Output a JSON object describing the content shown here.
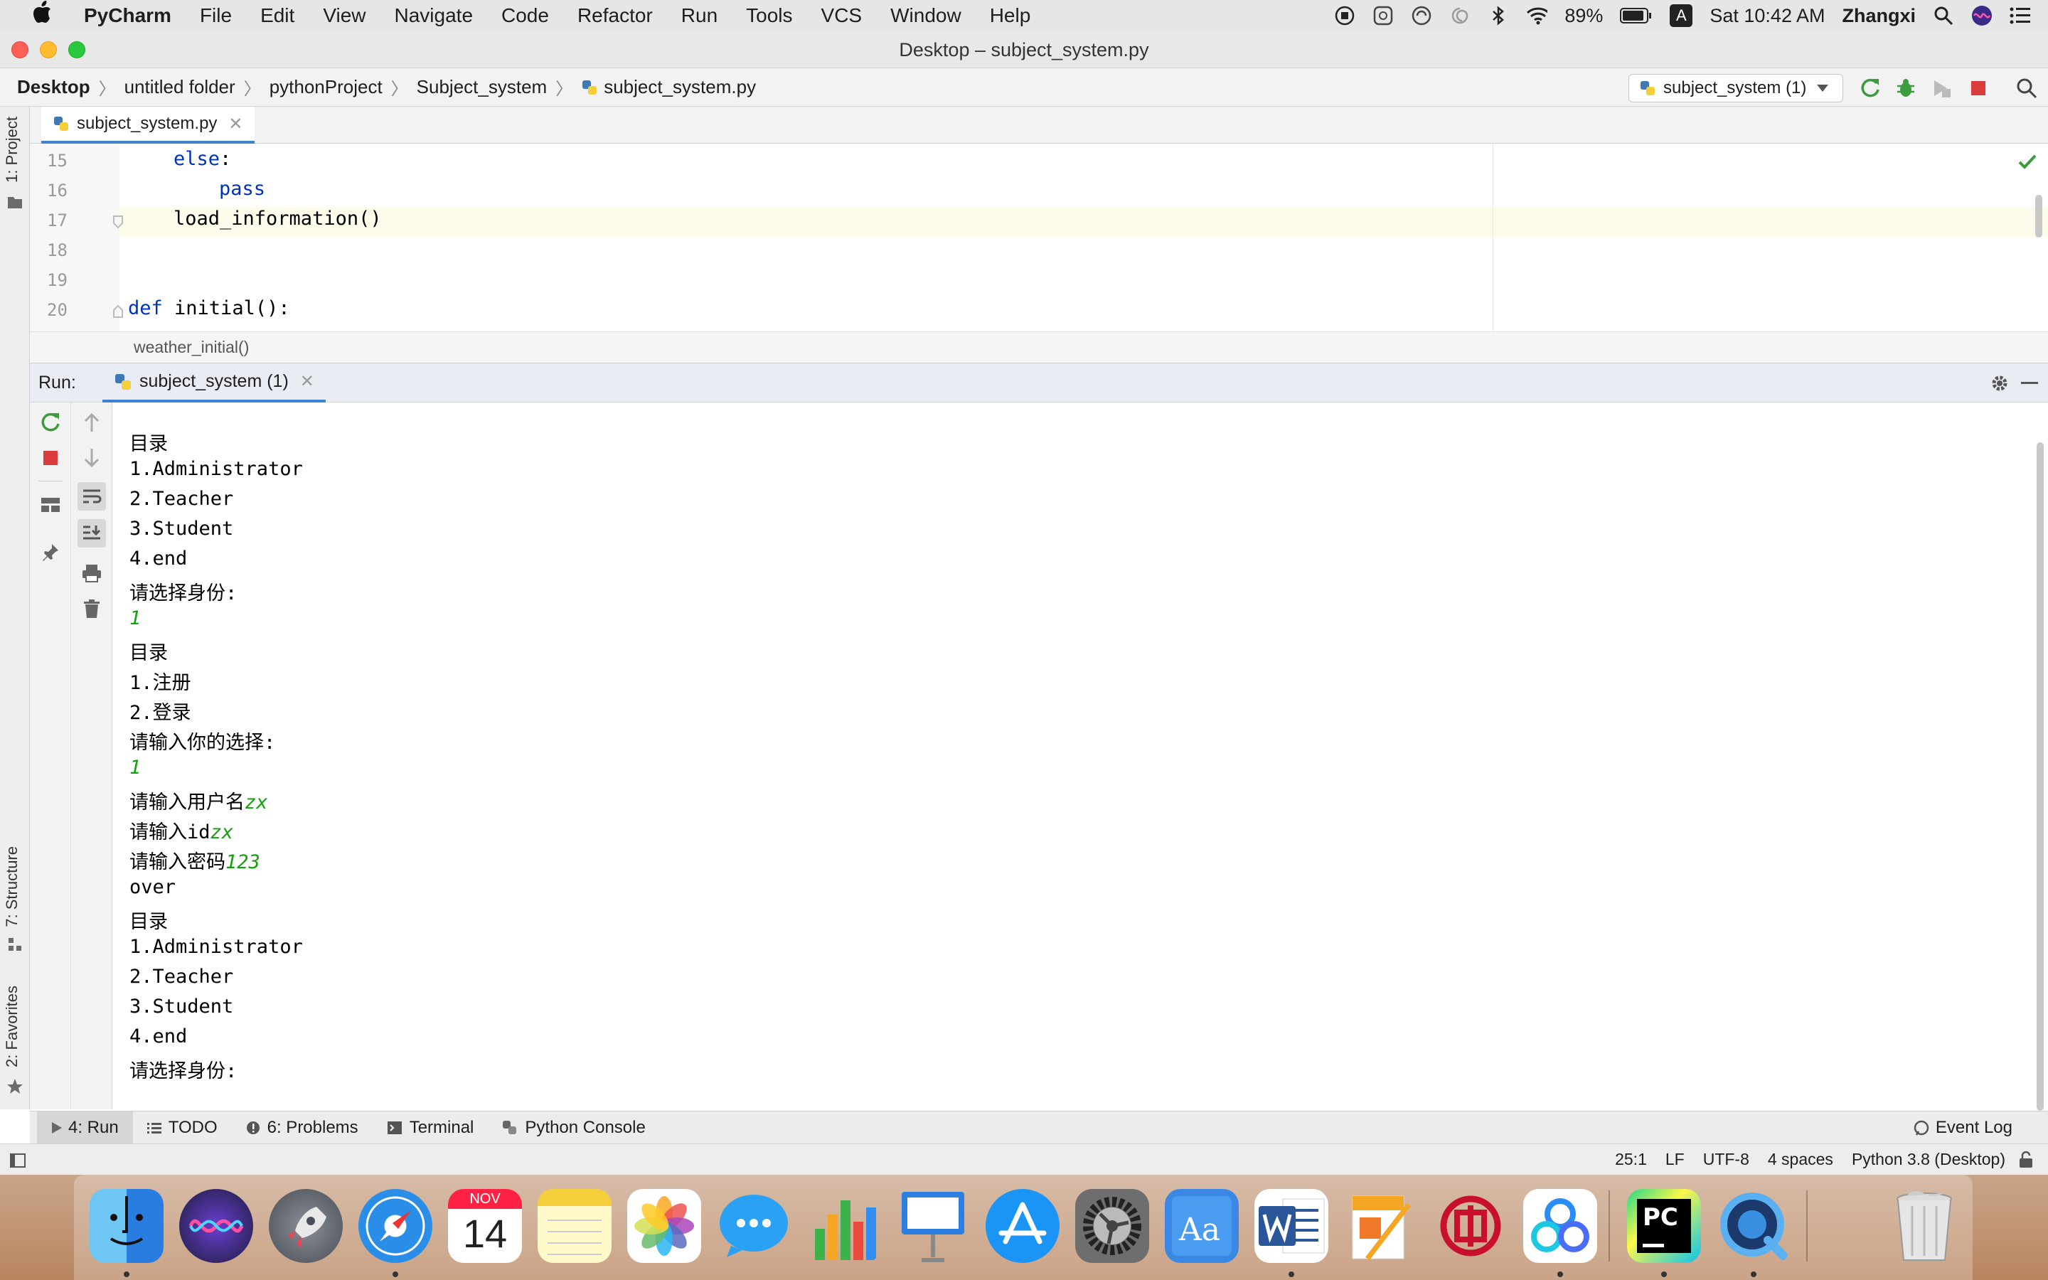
{
  "menubar": {
    "app_name": "PyCharm",
    "items": [
      "File",
      "Edit",
      "View",
      "Navigate",
      "Code",
      "Refactor",
      "Run",
      "Tools",
      "VCS",
      "Window",
      "Help"
    ],
    "battery": "89%",
    "input_source": "A",
    "datetime": "Sat 10:42 AM",
    "user": "Zhangxi"
  },
  "window": {
    "title": "Desktop – subject_system.py"
  },
  "navbar": {
    "crumbs": [
      "Desktop",
      "untitled folder",
      "pythonProject",
      "Subject_system",
      "subject_system.py"
    ],
    "run_config": "subject_system (1)"
  },
  "left_tool_windows": {
    "project": "1: Project",
    "structure": "7: Structure",
    "favorites": "2: Favorites"
  },
  "editor": {
    "tab": "subject_system.py",
    "line_numbers": [
      "15",
      "16",
      "17",
      "18",
      "19",
      "20"
    ],
    "lines": [
      {
        "kw": "else",
        "text": ":"
      },
      {
        "kw": "pass",
        "text": ""
      },
      {
        "kw": "",
        "text": "load_information()"
      },
      {
        "kw": "",
        "text": ""
      },
      {
        "kw": "",
        "text": ""
      },
      {
        "kw": "def",
        "text": " initial():"
      }
    ],
    "breadcrumb": "weather_initial()"
  },
  "run_panel": {
    "label": "Run:",
    "tab": "subject_system (1)",
    "output": [
      {
        "text": "目录",
        "input": ""
      },
      {
        "text": "1.Administrator",
        "input": ""
      },
      {
        "text": "2.Teacher",
        "input": ""
      },
      {
        "text": "3.Student",
        "input": ""
      },
      {
        "text": "4.end",
        "input": ""
      },
      {
        "text": "请选择身份:",
        "input": ""
      },
      {
        "text": "",
        "input": "1"
      },
      {
        "text": "目录",
        "input": ""
      },
      {
        "text": "1.注册",
        "input": ""
      },
      {
        "text": "2.登录",
        "input": ""
      },
      {
        "text": "请输入你的选择:",
        "input": ""
      },
      {
        "text": "",
        "input": "1"
      },
      {
        "text": "请输入用户名",
        "input": "zx"
      },
      {
        "text": "请输入id",
        "input": "zx"
      },
      {
        "text": "请输入密码",
        "input": "123"
      },
      {
        "text": "over",
        "input": ""
      },
      {
        "text": "目录",
        "input": ""
      },
      {
        "text": "1.Administrator",
        "input": ""
      },
      {
        "text": "2.Teacher",
        "input": ""
      },
      {
        "text": "3.Student",
        "input": ""
      },
      {
        "text": "4.end",
        "input": ""
      },
      {
        "text": "请选择身份:",
        "input": ""
      }
    ]
  },
  "bottom_tabs": {
    "run": "4: Run",
    "todo": "TODO",
    "problems": "6: Problems",
    "terminal": "Terminal",
    "python_console": "Python Console",
    "event_log": "Event Log"
  },
  "statusbar": {
    "position": "25:1",
    "line_sep": "LF",
    "encoding": "UTF-8",
    "indent": "4 spaces",
    "interpreter": "Python 3.8 (Desktop)"
  },
  "dock": {
    "calendar_month": "NOV",
    "calendar_day": "14",
    "pycharm_label": "PC"
  },
  "colors": {
    "accent": "#3d82d6",
    "keyword": "#0033b3",
    "console_input": "#13a10e",
    "run_green": "#3c9b3c",
    "stop_red": "#db3b3b"
  }
}
